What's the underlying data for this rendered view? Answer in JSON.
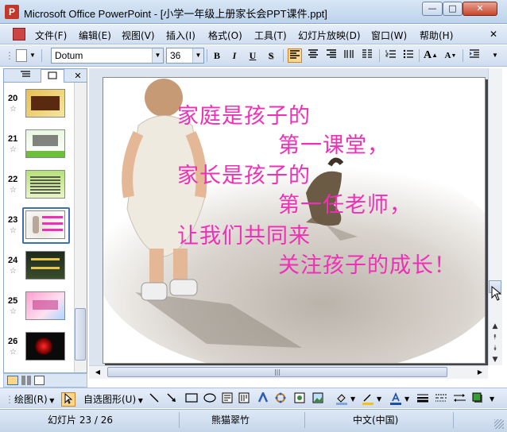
{
  "window": {
    "title": "Microsoft Office PowerPoint - [小学一年级上册家长会PPT课件.ppt]",
    "minimize_label": "—",
    "maximize_label": "□",
    "close_label": "✕"
  },
  "menu": {
    "items": [
      {
        "label": "文件(F)"
      },
      {
        "label": "编辑(E)"
      },
      {
        "label": "视图(V)"
      },
      {
        "label": "插入(I)"
      },
      {
        "label": "格式(O)"
      },
      {
        "label": "工具(T)"
      },
      {
        "label": "幻灯片放映(D)"
      },
      {
        "label": "窗口(W)"
      },
      {
        "label": "帮助(H)"
      }
    ],
    "close_label": "✕"
  },
  "toolbar": {
    "font_name": "Dotum",
    "font_size": "36",
    "bold": "B",
    "italic": "I",
    "underline": "U",
    "shadow": "S",
    "increase_font": "A",
    "decrease_font": "A"
  },
  "left_panel": {
    "tab_outline_icon": "outline-icon",
    "tab_slides_icon": "slides-icon",
    "close_label": "✕",
    "slides": [
      {
        "num": "20"
      },
      {
        "num": "21"
      },
      {
        "num": "22"
      },
      {
        "num": "23"
      },
      {
        "num": "24"
      },
      {
        "num": "25"
      },
      {
        "num": "26"
      }
    ],
    "selected_slide": "23"
  },
  "slide": {
    "lines": [
      "家庭是孩子的",
      "第一课堂，",
      "家长是孩子的",
      "第一任老师，",
      "让我们共同来",
      "关注孩子的成长！"
    ],
    "text_color": "#f02fb8"
  },
  "drawing_toolbar": {
    "draw_label": "绘图(R)",
    "autoshapes_label": "自选图形(U)"
  },
  "status": {
    "slide_position": "幻灯片 23 / 26",
    "design": "熊猫翠竹",
    "language": "中文(中国)"
  }
}
